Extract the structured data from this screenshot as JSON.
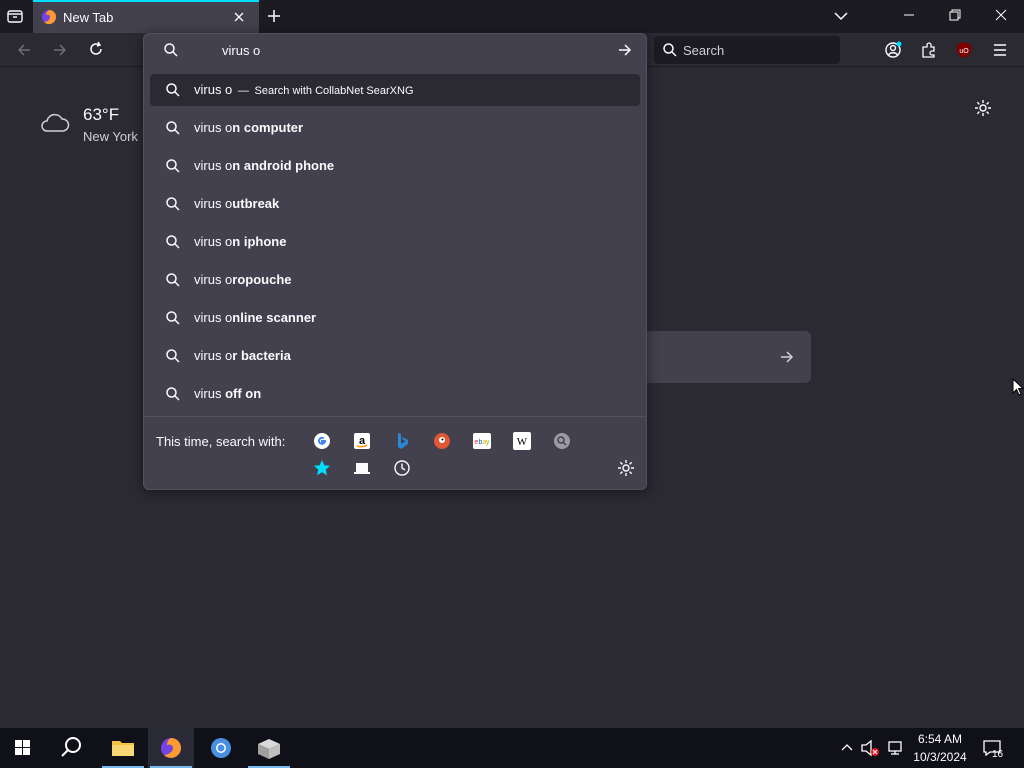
{
  "browser": {
    "tab_title": "New Tab",
    "searchbar_placeholder": "Search"
  },
  "weather": {
    "temperature": "63°F",
    "location": "New York"
  },
  "urlbar": {
    "input_value": "virus o",
    "first_row": {
      "query": "virus o",
      "separator": "—",
      "action": "Search with CollabNet SearXNG"
    },
    "suggestions": [
      {
        "typed": "virus o",
        "completion": "n computer"
      },
      {
        "typed": "virus o",
        "completion": "n android phone"
      },
      {
        "typed": "virus o",
        "completion": "utbreak"
      },
      {
        "typed": "virus o",
        "completion": "n iphone"
      },
      {
        "typed": "virus o",
        "completion": "ropouche"
      },
      {
        "typed": "virus o",
        "completion": "nline scanner"
      },
      {
        "typed": "virus o",
        "completion": "r bacteria"
      },
      {
        "typed": "virus ",
        "completion": "off on",
        "trail": ""
      }
    ],
    "oneoff_label": "This time, search with:",
    "engines": [
      "google-icon",
      "amazon-icon",
      "bing-icon",
      "duckduckgo-icon",
      "ebay-icon",
      "wikipedia-icon",
      "searxng-icon",
      "bookmarks-icon",
      "tabs-icon",
      "history-icon"
    ]
  },
  "taskbar": {
    "time": "6:54 AM",
    "date": "10/3/2024",
    "notifications": "16"
  },
  "colors": {
    "accent": "#00ddff",
    "background": "#2b2a33",
    "popup": "#42414d"
  }
}
